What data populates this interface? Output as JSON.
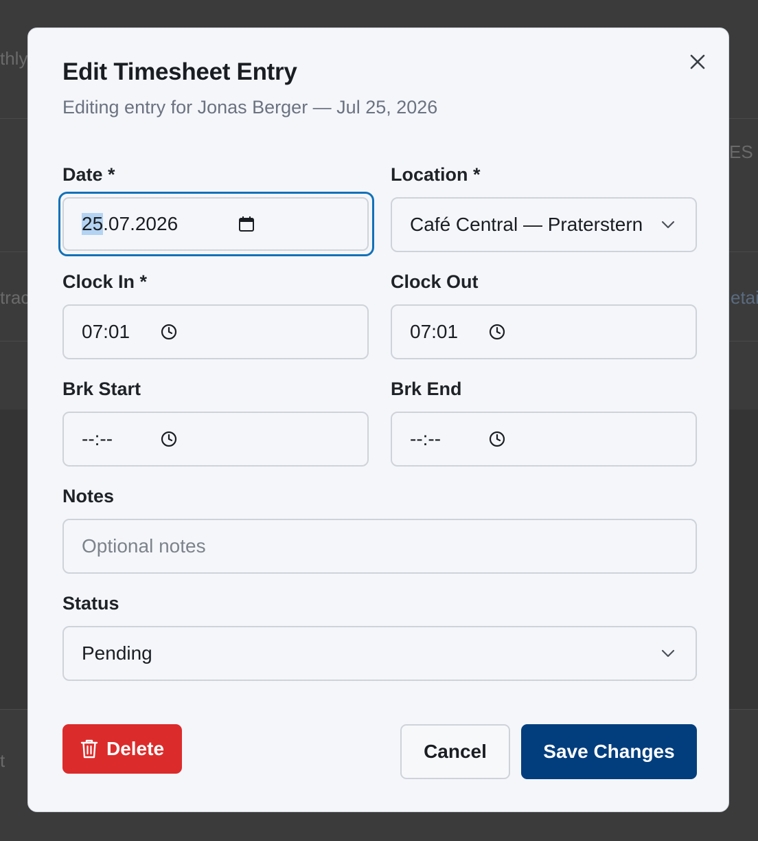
{
  "background": {
    "fragments": [
      "thly",
      "ES",
      "trac",
      "etail",
      "t"
    ]
  },
  "modal": {
    "title": "Edit Timesheet Entry",
    "subtitle": "Editing entry for Jonas Berger — Jul 25, 2026",
    "close_icon": "close-icon"
  },
  "form": {
    "date": {
      "label": "Date *",
      "value_selected_part": "25",
      "value_rest": ".07.2026",
      "icon": "calendar-icon"
    },
    "location": {
      "label": "Location *",
      "value": "Café Central — Praterstern",
      "icon": "chevron-down-icon"
    },
    "clock_in": {
      "label": "Clock In *",
      "value": "07:01",
      "icon": "clock-icon"
    },
    "clock_out": {
      "label": "Clock Out",
      "value": "07:01",
      "icon": "clock-icon"
    },
    "break_start": {
      "label": "Brk Start",
      "value": "--:--",
      "icon": "clock-icon"
    },
    "break_end": {
      "label": "Brk End",
      "value": "--:--",
      "icon": "clock-icon"
    },
    "notes": {
      "label": "Notes",
      "placeholder": "Optional notes",
      "value": ""
    },
    "status": {
      "label": "Status",
      "value": "Pending",
      "icon": "chevron-down-icon"
    }
  },
  "actions": {
    "delete_label": "Delete",
    "cancel_label": "Cancel",
    "save_label": "Save Changes"
  },
  "colors": {
    "accent_focus": "#1271b8",
    "primary_button": "#023e7d",
    "danger_button": "#dc2b2b"
  }
}
